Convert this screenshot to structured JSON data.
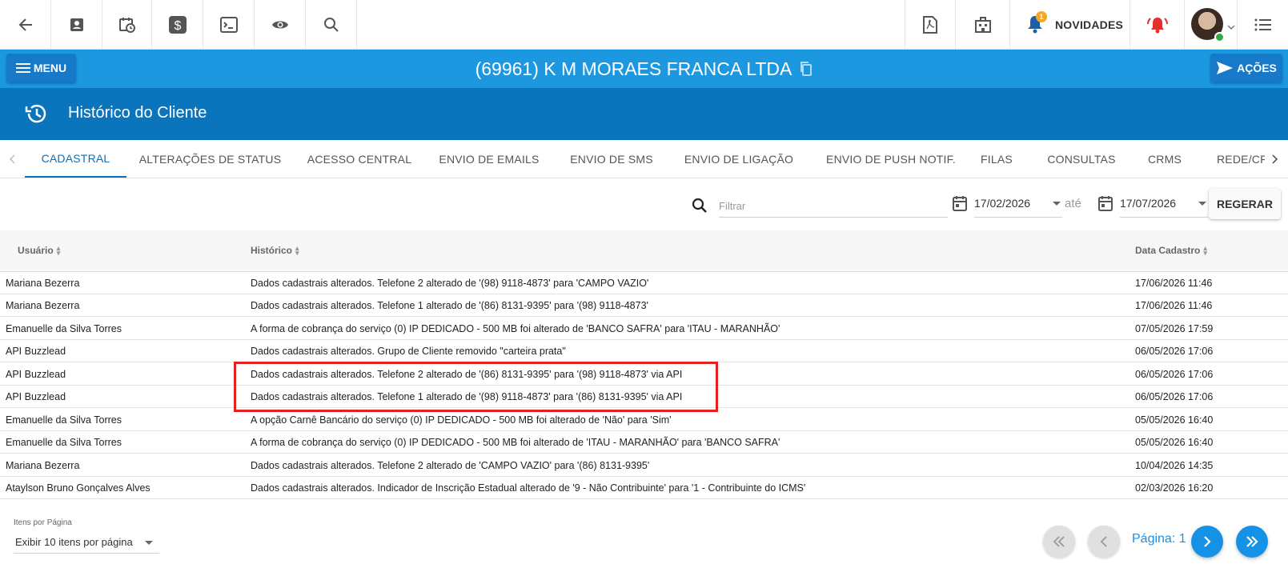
{
  "topbar": {
    "icons": [
      "back-arrow-icon",
      "contact-card-icon",
      "calendar-clock-icon",
      "dollar-icon",
      "terminal-icon",
      "eye-icon",
      "search-icon",
      "pdf-icon",
      "building-icon",
      "bell-icon",
      "alarm-icon",
      "list-menu-icon"
    ],
    "novidades_label": "NOVIDADES",
    "novidades_badge": "1"
  },
  "header": {
    "menu_label": "MENU",
    "client_title": "(69961) K M MORAES FRANCA LTDA",
    "acoes_label": "AÇÕES"
  },
  "section": {
    "title": "Histórico do Cliente"
  },
  "tabs": [
    {
      "label": "CADASTRAL",
      "active": true
    },
    {
      "label": "ALTERAÇÕES DE STATUS"
    },
    {
      "label": "ACESSO CENTRAL"
    },
    {
      "label": "ENVIO DE EMAILS"
    },
    {
      "label": "ENVIO DE SMS"
    },
    {
      "label": "ENVIO DE LIGAÇÃO"
    },
    {
      "label": "ENVIO DE PUSH NOTIF."
    },
    {
      "label": "FILAS"
    },
    {
      "label": "CONSULTAS"
    },
    {
      "label": "CRMS"
    },
    {
      "label": "REDE/CF"
    }
  ],
  "filters": {
    "filter_placeholder": "Filtrar",
    "date_from": "17/02/2026",
    "ate_label": "até",
    "date_to": "17/07/2026",
    "regerar_label": "REGERAR"
  },
  "table": {
    "headers": {
      "user": "Usuário",
      "history": "Histórico",
      "date": "Data Cadastro"
    },
    "rows": [
      {
        "user": "Mariana Bezerra",
        "history": "Dados cadastrais alterados. Telefone 2 alterado de '(98) 9118-4873' para 'CAMPO VAZIO'",
        "date": "17/06/2026 11:46"
      },
      {
        "user": "Mariana Bezerra",
        "history": "Dados cadastrais alterados. Telefone 1 alterado de '(86) 8131-9395' para '(98) 9118-4873'",
        "date": "17/06/2026 11:46"
      },
      {
        "user": "Emanuelle da Silva Torres",
        "history": "A forma de cobrança do serviço (0) IP DEDICADO - 500 MB foi alterado de 'BANCO SAFRA' para 'ITAU - MARANHÃO'",
        "date": "07/05/2026 17:59"
      },
      {
        "user": "API Buzzlead",
        "history": "Dados cadastrais alterados. Grupo de Cliente removido \"carteira prata\"",
        "date": "06/05/2026 17:06"
      },
      {
        "user": "API Buzzlead",
        "history": "Dados cadastrais alterados. Telefone 2 alterado de '(86) 8131-9395' para '(98) 9118-4873' via API",
        "date": "06/05/2026 17:06"
      },
      {
        "user": "API Buzzlead",
        "history": "Dados cadastrais alterados. Telefone 1 alterado de '(98) 9118-4873' para '(86) 8131-9395' via API",
        "date": "06/05/2026 17:06"
      },
      {
        "user": "Emanuelle da Silva Torres",
        "history": "A opção Carnê Bancário do serviço (0) IP DEDICADO - 500 MB foi alterado de 'Não' para 'Sim'",
        "date": "05/05/2026 16:40"
      },
      {
        "user": "Emanuelle da Silva Torres",
        "history": "A forma de cobrança do serviço (0) IP DEDICADO - 500 MB foi alterado de 'ITAU - MARANHÃO' para 'BANCO SAFRA'",
        "date": "05/05/2026 16:40"
      },
      {
        "user": "Mariana Bezerra",
        "history": "Dados cadastrais alterados. Telefone 2 alterado de 'CAMPO VAZIO' para '(86) 8131-9395'",
        "date": "10/04/2026 14:35"
      },
      {
        "user": "Ataylson Bruno Gonçalves Alves",
        "history": "Dados cadastrais alterados. Indicador de Inscrição Estadual alterado de '9 - Não Contribuinte' para '1 - Contribuinte do ICMS'",
        "date": "02/03/2026 16:20"
      }
    ]
  },
  "footer": {
    "items_per_page_label": "Itens por Página",
    "items_per_page_value": "Exibir 10 itens por página",
    "page_label": "Página: 1"
  },
  "colors": {
    "header_blue": "#1b98e0",
    "section_blue": "#0a75bd",
    "highlight_red": "#e32121",
    "active_page": "#1592e6"
  }
}
